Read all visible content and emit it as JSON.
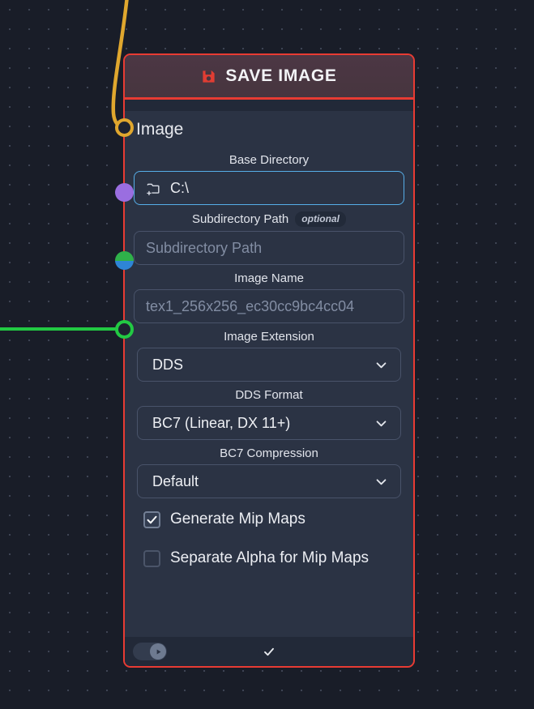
{
  "canvas": {
    "background_color": "#191d28",
    "grid_dot_color": "#96a0b9",
    "grid_spacing": 24
  },
  "node": {
    "title": "SAVE IMAGE",
    "icon": "save-floppy-icon",
    "accent_color": "#e83b33",
    "header_color": "#4c3744",
    "body_color": "#2b3344",
    "output": {
      "label": "Image",
      "port_color": "#e0a72e"
    },
    "ports": [
      {
        "name": "image-output-port",
        "color": "#e0a72e",
        "style": "ring",
        "connected": true
      },
      {
        "name": "base-directory-port",
        "color": "#9a6ee0",
        "style": "solid",
        "connected": false
      },
      {
        "name": "subdirectory-path-port",
        "color_top": "#2fb14a",
        "color_bottom": "#2e85d6",
        "style": "split",
        "connected": false
      },
      {
        "name": "image-name-port",
        "color": "#22c943",
        "style": "ring",
        "connected": true
      }
    ],
    "fields": {
      "base_directory": {
        "label": "Base Directory",
        "value": "C:\\",
        "icon": "folder-plus-icon",
        "focused": true
      },
      "subdirectory_path": {
        "label": "Subdirectory Path",
        "badge": "optional",
        "value": "",
        "placeholder": "Subdirectory Path"
      },
      "image_name": {
        "label": "Image Name",
        "value": "",
        "placeholder": "tex1_256x256_ec30cc9bc4cc04"
      },
      "image_extension": {
        "label": "Image Extension",
        "value": "DDS"
      },
      "dds_format": {
        "label": "DDS Format",
        "value": "BC7 (Linear, DX 11+)"
      },
      "bc7_compression": {
        "label": "BC7 Compression",
        "value": "Default"
      }
    },
    "checkboxes": [
      {
        "label": "Generate Mip Maps",
        "checked": true
      },
      {
        "label": "Separate Alpha for Mip Maps",
        "checked": false
      }
    ],
    "footer": {
      "toggle": {
        "name": "run-toggle",
        "state": "on",
        "icon": "play-icon"
      },
      "confirm": {
        "name": "confirm-button",
        "icon": "check-icon"
      }
    }
  },
  "wires": [
    {
      "name": "image-input-wire",
      "color": "#e0a72e"
    },
    {
      "name": "image-name-wire",
      "color": "#22c943"
    }
  ]
}
